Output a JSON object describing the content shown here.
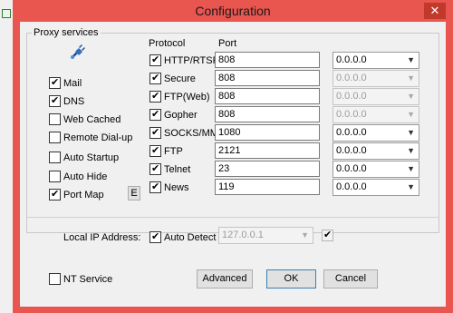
{
  "window": {
    "title": "Configuration",
    "close_glyph": "✕"
  },
  "proxy_group": {
    "label": "Proxy services",
    "services": [
      {
        "label": "Mail",
        "checked": true
      },
      {
        "label": "DNS",
        "checked": true
      },
      {
        "label": "Web Cached",
        "checked": false
      },
      {
        "label": "Remote Dial-up",
        "checked": false
      },
      {
        "label": "Auto Startup",
        "checked": false
      },
      {
        "label": "Auto Hide",
        "checked": false
      },
      {
        "label": "Port Map",
        "checked": true
      }
    ],
    "port_map_button": "E",
    "protocol_header": "Protocol",
    "port_header": "Port",
    "protocols": [
      {
        "label": "HTTP/RTSP",
        "checked": true,
        "port": "808",
        "address": "0.0.0.0",
        "address_enabled": true
      },
      {
        "label": "Secure",
        "checked": true,
        "port": "808",
        "address": "0.0.0.0",
        "address_enabled": false
      },
      {
        "label": "FTP(Web)",
        "checked": true,
        "port": "808",
        "address": "0.0.0.0",
        "address_enabled": false
      },
      {
        "label": "Gopher",
        "checked": true,
        "port": "808",
        "address": "0.0.0.0",
        "address_enabled": false
      },
      {
        "label": "SOCKS/MMS",
        "checked": true,
        "port": "1080",
        "address": "0.0.0.0",
        "address_enabled": true
      },
      {
        "label": "FTP",
        "checked": true,
        "port": "2121",
        "address": "0.0.0.0",
        "address_enabled": true
      },
      {
        "label": "Telnet",
        "checked": true,
        "port": "23",
        "address": "0.0.0.0",
        "address_enabled": true
      },
      {
        "label": "News",
        "checked": true,
        "port": "119",
        "address": "0.0.0.0",
        "address_enabled": true
      }
    ]
  },
  "local_ip": {
    "label": "Local IP Address:",
    "auto_detect_label": "Auto Detect",
    "auto_detect_checked": true,
    "address": "127.0.0.1",
    "extra_checked": true
  },
  "footer": {
    "nt_service_label": "NT Service",
    "nt_service_checked": false,
    "advanced_label": "Advanced",
    "ok_label": "OK",
    "cancel_label": "Cancel"
  },
  "colors": {
    "title_bar": "#e9554f",
    "close_button": "#c0392b",
    "dialog_bg": "#f0f0f0"
  }
}
